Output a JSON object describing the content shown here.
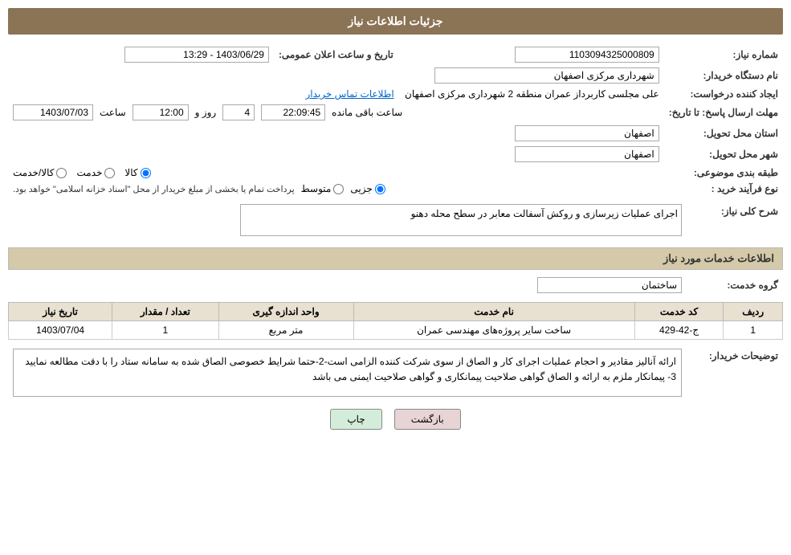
{
  "header": {
    "title": "جزئیات اطلاعات نیاز"
  },
  "fields": {
    "need_number_label": "شماره نیاز:",
    "need_number_value": "1103094325000809",
    "buyer_org_label": "نام دستگاه خریدار:",
    "buyer_org_value": "شهرداری مرکزی اصفهان",
    "creator_label": "ایجاد کننده درخواست:",
    "creator_value": "علی مجلسی کاربرداز عمران منطقه 2 شهرداری مرکزی اصفهان",
    "creator_link": "اطلاعات تماس خریدار",
    "announce_date_label": "تاریخ و ساعت اعلان عمومی:",
    "announce_date_value": "1403/06/29 - 13:29",
    "deadline_label": "مهلت ارسال پاسخ: تا تاریخ:",
    "deadline_date": "1403/07/03",
    "deadline_time_label": "ساعت",
    "deadline_time": "12:00",
    "deadline_days_label": "روز و",
    "deadline_days": "4",
    "deadline_remaining_label": "ساعت باقی مانده",
    "deadline_remaining": "22:09:45",
    "province_label": "استان محل تحویل:",
    "province_value": "اصفهان",
    "city_label": "شهر محل تحویل:",
    "city_value": "اصفهان",
    "category_label": "طبقه بندی موضوعی:",
    "category_kala": "کالا",
    "category_khadamat": "خدمت",
    "category_kala_khadamat": "کالا/خدمت",
    "process_label": "نوع فرآیند خرید :",
    "process_jozvi": "جزیی",
    "process_motavaset": "متوسط",
    "process_note": "پرداخت تمام یا بخشی از مبلغ خریدار از محل \"اسناد خزانه اسلامی\" خواهد بود.",
    "need_desc_label": "شرح کلی نیاز:",
    "need_desc_value": "اجرای عملیات زیرسازی و روکش آسفالت معابر در سطح محله دهنو",
    "services_title": "اطلاعات خدمات مورد نیاز",
    "service_group_label": "گروه خدمت:",
    "service_group_value": "ساختمان",
    "table": {
      "headers": [
        "ردیف",
        "کد خدمت",
        "نام خدمت",
        "واحد اندازه گیری",
        "تعداد / مقدار",
        "تاریخ نیاز"
      ],
      "rows": [
        {
          "row": "1",
          "code": "ج-42-429",
          "name": "ساخت سایر پروژه‌های مهندسی عمران",
          "unit": "متر مربع",
          "qty": "1",
          "date": "1403/07/04"
        }
      ]
    },
    "buyer_notes_label": "توضیحات خریدار:",
    "buyer_notes_value": "ارائه آنالیز مقادیر و احجام عملیات اجرای کار و الصاق از سوی شرکت کننده الزامی است-2-حتما شرایط خصوصی الصاق شده به سامانه ستاد را با دقت مطالعه نمایید 3- پیمانکار ملزم به ارائه و الصاق گواهی صلاحیت پیمانکاری و گواهی صلاحیت ایمنی می باشد"
  },
  "buttons": {
    "print": "چاپ",
    "back": "بازگشت"
  }
}
